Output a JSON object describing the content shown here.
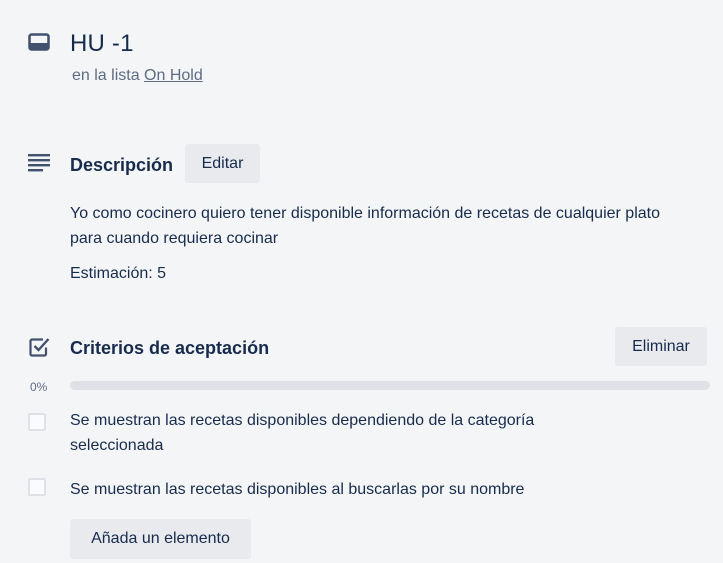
{
  "card": {
    "title": "HU -1",
    "list_prefix": "en la lista",
    "list_name": "On Hold"
  },
  "description": {
    "heading": "Descripción",
    "edit_label": "Editar",
    "text": "Yo como cocinero quiero tener disponible información de recetas de cualquier plato para cuando requiera cocinar",
    "estimation": "Estimación: 5"
  },
  "checklist": {
    "heading": "Criterios de aceptación",
    "delete_label": "Eliminar",
    "progress_label": "0%",
    "progress_fraction": 0,
    "items": [
      {
        "text": "Se muestran las recetas disponibles dependiendo de la categoría seleccionada",
        "checked": false
      },
      {
        "text": "Se muestran las recetas disponibles al buscarlas por su nombre",
        "checked": false
      }
    ],
    "add_label": "Añada un elemento"
  },
  "colors": {
    "background": "#f4f5f7",
    "text": "#172b4d",
    "muted": "#5e6c84",
    "button_bg": "#e9eaee",
    "progress_track": "#dfe1e6"
  },
  "icons": {
    "card": "card-icon",
    "description": "description-lines-icon",
    "checklist": "checkbox-checked-icon"
  }
}
